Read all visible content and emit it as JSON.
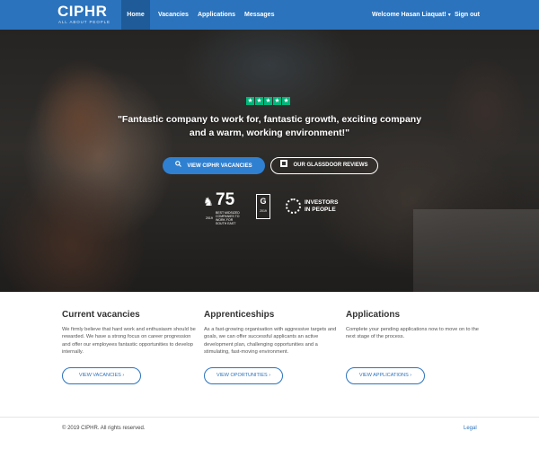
{
  "nav": {
    "brand": "CIPHR",
    "brand_tagline": "ALL ABOUT PEOPLE",
    "items": [
      {
        "label": "Home",
        "active": true
      },
      {
        "label": "Vacancies",
        "active": false
      },
      {
        "label": "Applications",
        "active": false
      },
      {
        "label": "Messages",
        "active": false
      }
    ],
    "user": "Welcome Hasan Liaquat!",
    "user_caret": "▾",
    "signout": "Sign out"
  },
  "hero": {
    "rating_stars": 5,
    "star_glyph": "★",
    "quote": "\"Fantastic company to work for, fantastic growth, exciting company and a warm, working environment!\"",
    "btn_vacancies": "VIEW CIPHR VACANCIES",
    "btn_vacancies_icon": "search-icon",
    "btn_glassdoor": "OUR GLASSDOOR REVIEWS",
    "btn_glassdoor_icon": "glassdoor-icon",
    "award_75": {
      "number": "75",
      "caption": "BEST MIDSIZED COMPANIES TO WORK FOR SOUTH EAST",
      "year": "2019"
    },
    "award_glassdoor": {
      "letter": "G",
      "year": "2019"
    },
    "award_iip": {
      "line1": "INVESTORS",
      "line2": "IN PEOPLE"
    }
  },
  "sections": [
    {
      "title": "Current vacancies",
      "text": "We firmly believe that hard work and enthusiasm should be rewarded. We have a strong focus on career progression and offer our employees fantastic opportunities to develop internally.",
      "button": "VIEW VACANCIES  ›"
    },
    {
      "title": "Apprenticeships",
      "text": "As a fast-growing organisation with aggressive targets and goals, we can offer successful applicants an active development plan, challenging opportunities and a stimulating, fast-moving environment.",
      "button": "VIEW OPORTUNITIES  ›"
    },
    {
      "title": "Applications",
      "text": "Complete your pending applications now to move on to the next stage of the process.",
      "button": "VIEW APPLICATIONS  ›"
    }
  ],
  "footer": {
    "copyright": "© 2019 CIPHR. All rights reserved.",
    "legal": "Legal"
  },
  "colors": {
    "brand_blue": "#2b73bd",
    "trustpilot_green": "#00b67a"
  }
}
